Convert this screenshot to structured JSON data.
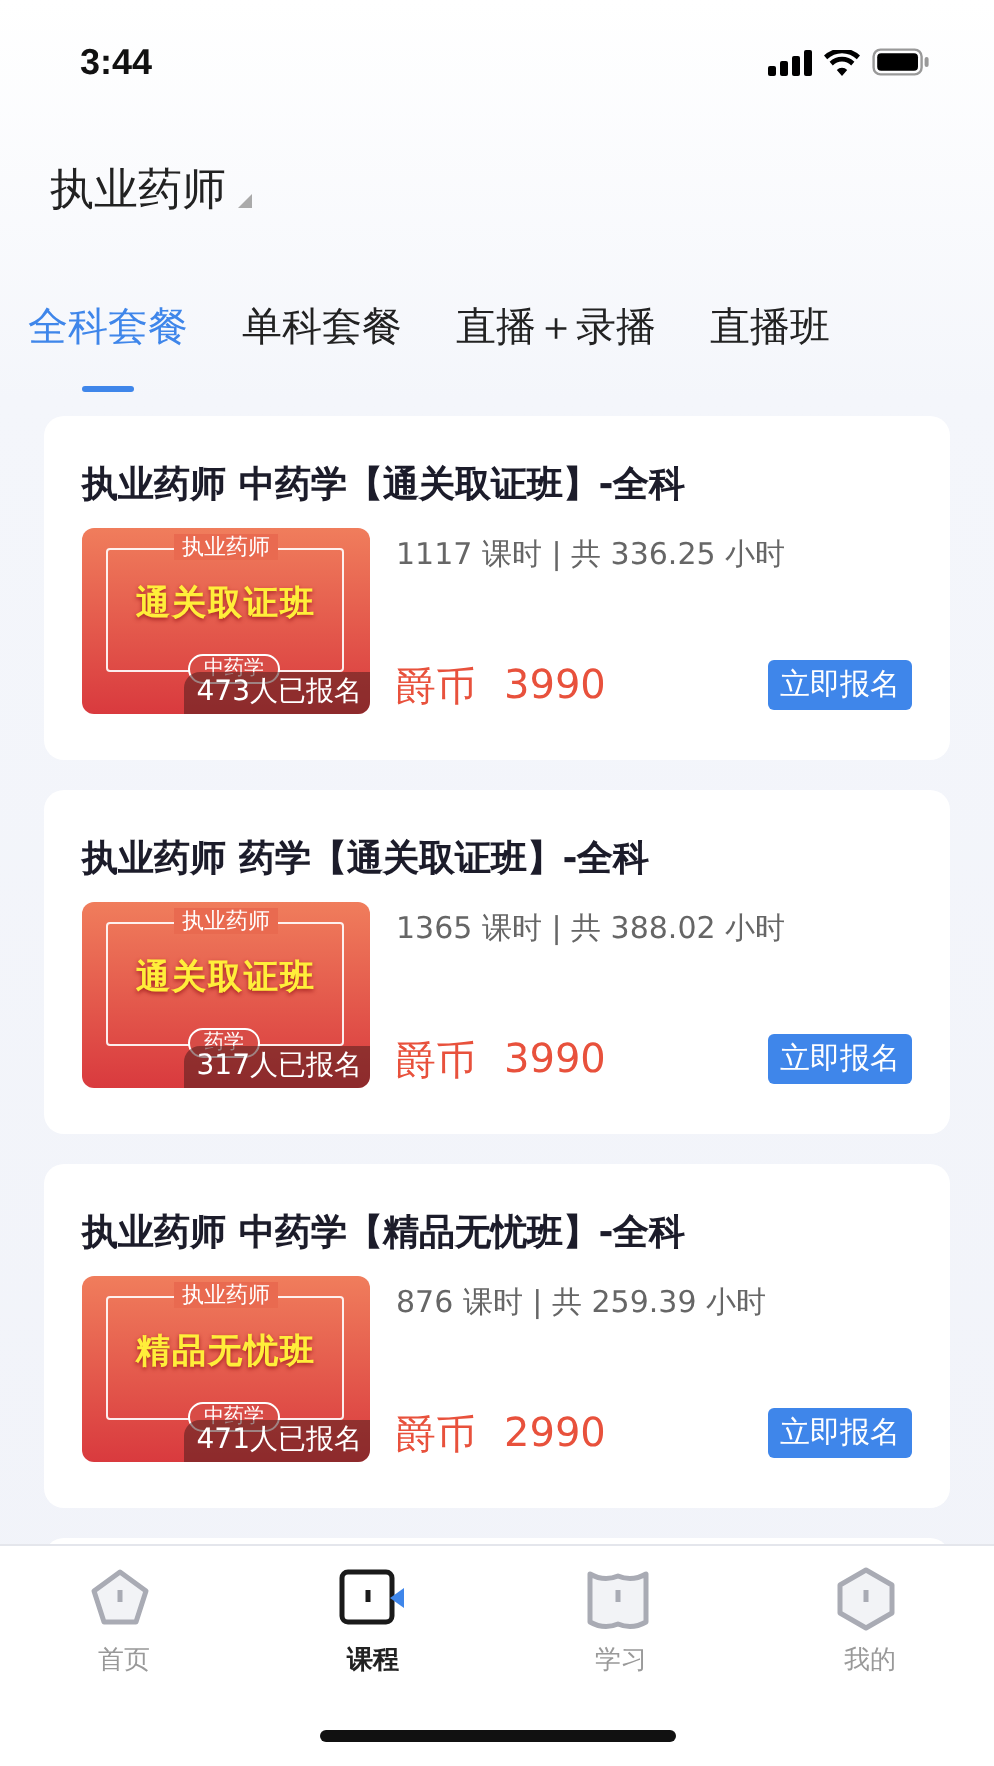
{
  "status_bar": {
    "time": "3:44"
  },
  "header": {
    "title": "执业药师"
  },
  "tabs": [
    {
      "label": "全科套餐",
      "selected": true
    },
    {
      "label": "单科套餐",
      "selected": false
    },
    {
      "label": "直播＋录播",
      "selected": false
    },
    {
      "label": "直播班",
      "selected": false
    }
  ],
  "courses": [
    {
      "title": "执业药师 中药学【通关取证班】-全科",
      "thumbnail": {
        "top": "执业药师",
        "headline": "通关取证班",
        "subject": "中药学"
      },
      "enrolled": "473人已报名",
      "meta": "1117 课时 | 共 336.25 小时",
      "currency": "爵币",
      "price": "3990",
      "button": "立即报名"
    },
    {
      "title": "执业药师 药学【通关取证班】-全科",
      "thumbnail": {
        "top": "执业药师",
        "headline": "通关取证班",
        "subject": "药学"
      },
      "enrolled": "317人已报名",
      "meta": "1365 课时 | 共 388.02 小时",
      "currency": "爵币",
      "price": "3990",
      "button": "立即报名"
    },
    {
      "title": "执业药师 中药学【精品无忧班】-全科",
      "thumbnail": {
        "top": "执业药师",
        "headline": "精品无忧班",
        "subject": "中药学"
      },
      "enrolled": "471人已报名",
      "meta": "876 课时 | 共 259.39 小时",
      "currency": "爵币",
      "price": "2990",
      "button": "立即报名"
    }
  ],
  "bottom_nav": [
    {
      "label": "首页",
      "kind": "pentagon",
      "selected": false
    },
    {
      "label": "课程",
      "kind": "square",
      "selected": true
    },
    {
      "label": "学习",
      "kind": "book",
      "selected": false
    },
    {
      "label": "我的",
      "kind": "hexagon",
      "selected": false
    }
  ]
}
